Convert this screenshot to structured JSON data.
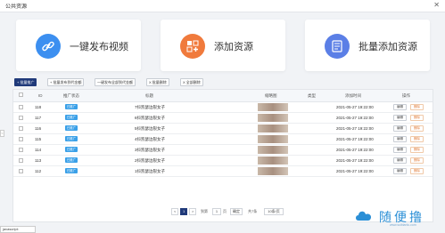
{
  "window": {
    "title": "公共资源",
    "close_glyph": "✕"
  },
  "cards": [
    {
      "label": "一键发布视频",
      "icon": "link-icon",
      "color": "#3c8ff0",
      "bg": "#dfeefd"
    },
    {
      "label": "添加资源",
      "icon": "add-resource-icon",
      "color": "#f07a3c",
      "bg": "#fde6d8"
    },
    {
      "label": "批量添加资源",
      "icon": "batch-add-icon",
      "color": "#5b7fe6",
      "bg": "#e2e9fb"
    }
  ],
  "toolbar": {
    "promote": "+ 批量推广",
    "batch_publish": "+ 批量发布到代金额",
    "one_click": "一键发布全部到代金额",
    "batch_delete": "X 批量删除",
    "delete_all": "X 全部删除"
  },
  "table": {
    "columns": [
      "ID",
      "推广状态",
      "标题",
      "缩略图",
      "类型",
      "添加时间",
      "操作"
    ],
    "rows": [
      {
        "id": "118",
        "status": "已推广",
        "title": "7抖凯瑟边裂女子",
        "time": "2021-05-27 19:22:00",
        "edit": "编辑",
        "delete": "删除"
      },
      {
        "id": "117",
        "status": "已推广",
        "title": "6抖凯瑟边裂女子",
        "time": "2021-05-27 19:22:00",
        "edit": "编辑",
        "delete": "删除"
      },
      {
        "id": "116",
        "status": "已推广",
        "title": "5抖凯瑟边裂女子",
        "time": "2021-05-27 19:22:00",
        "edit": "编辑",
        "delete": "删除"
      },
      {
        "id": "115",
        "status": "已推广",
        "title": "4抖凯瑟边裂女子",
        "time": "2021-05-27 19:22:00",
        "edit": "编辑",
        "delete": "删除"
      },
      {
        "id": "114",
        "status": "已推广",
        "title": "3抖凯瑟边裂女子",
        "time": "2021-05-27 19:22:00",
        "edit": "编辑",
        "delete": "删除"
      },
      {
        "id": "113",
        "status": "已推广",
        "title": "2抖凯瑟边裂女子",
        "time": "2021-05-27 19:22:00",
        "edit": "编辑",
        "delete": "删除"
      },
      {
        "id": "112",
        "status": "已推广",
        "title": "1抖凯瑟边裂女子",
        "time": "2021-05-27 19:22:00",
        "edit": "编辑",
        "delete": "删除"
      }
    ]
  },
  "pager": {
    "prev": "<",
    "current": "1",
    "next": ">",
    "goto_label": "到第",
    "page_input": "1",
    "page_unit": "页",
    "confirm": "确定",
    "total": "共7条",
    "per_page": "10条/页"
  },
  "status_bar": "javascript:",
  "side_tab": "<",
  "watermark": {
    "text": "随便撸",
    "sub": "www.suibianlu.com"
  }
}
